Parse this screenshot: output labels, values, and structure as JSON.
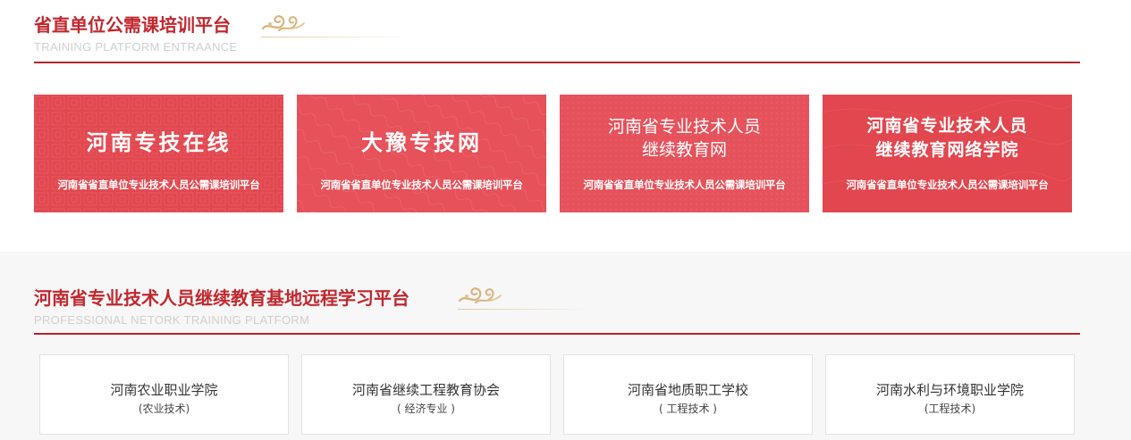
{
  "section1": {
    "title": "省直单位公需课培训平台",
    "subtitle": "TRAINING PLATFORM ENTRAANCE",
    "accent": "#b3262d",
    "cards": [
      {
        "title": "河南专技在线",
        "subtitle": "河南省省直单位专业技术人员公需课培训平台",
        "color": "#e2474f"
      },
      {
        "title": "大豫专技网",
        "subtitle": "河南省省直单位专业技术人员公需课培训平台",
        "color": "#e6515a"
      },
      {
        "title_line1": "河南省专业技术人员",
        "title_line2": "继续教育网",
        "subtitle": "河南省省直单位专业技术人员公需课培训平台",
        "color": "#e5525b"
      },
      {
        "title_line1": "河南省专业技术人员",
        "title_line2": "继续教育网络学院",
        "subtitle": "河南省省直单位专业技术人员公需课培训平台",
        "color": "#e2464e"
      }
    ]
  },
  "section2": {
    "title": "河南省专业技术人员继续教育基地远程学习平台",
    "subtitle": "PROFESSIONAL NETORK TRAINING PLATFORM",
    "institutions": [
      {
        "name": "河南农业职业学院",
        "note": "(农业技术)"
      },
      {
        "name": "河南省继续工程教育协会",
        "note": "( 经济专业 )"
      },
      {
        "name": "河南省地质职工学校",
        "note": "( 工程技术 )"
      },
      {
        "name": "河南水利与环境职业学院",
        "note": "(工程技术)"
      }
    ]
  },
  "icons": [
    "cloud-ornament-icon"
  ]
}
